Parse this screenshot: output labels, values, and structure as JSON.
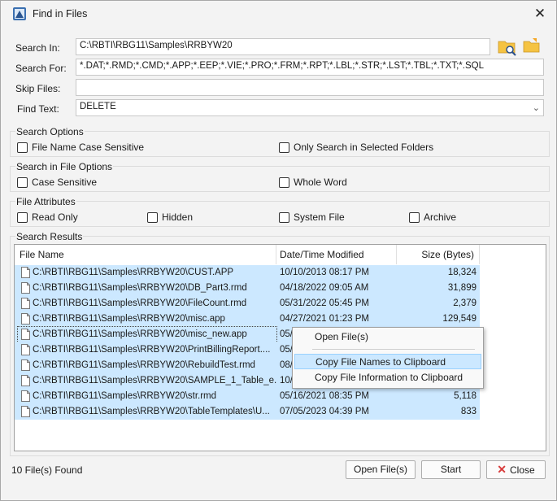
{
  "window": {
    "title": "Find in Files"
  },
  "form": {
    "search_in_label": "Search In:",
    "search_in_value": "C:\\RBTI\\RBG11\\Samples\\RRBYW20",
    "search_for_label": "Search For:",
    "search_for_value": "*.DAT;*.RMD;*.CMD;*.APP;*.EEP;*.VIE;*.PRO;*.FRM;*.RPT;*.LBL;*.STR;*.LST;*.TBL;*.TXT;*.SQL",
    "skip_files_label": "Skip Files:",
    "skip_files_value": "",
    "find_text_label": "Find Text:",
    "find_text_value": "DELETE"
  },
  "search_options": {
    "title": "Search Options",
    "file_name_case_sensitive": "File Name Case Sensitive",
    "only_selected_folders": "Only Search in Selected Folders"
  },
  "file_options": {
    "title": "Search in File Options",
    "case_sensitive": "Case Sensitive",
    "whole_word": "Whole Word"
  },
  "file_attributes": {
    "title": "File Attributes",
    "read_only": "Read Only",
    "hidden": "Hidden",
    "system_file": "System File",
    "archive": "Archive"
  },
  "results": {
    "title": "Search Results",
    "columns": [
      "File Name",
      "Date/Time Modified",
      "Size (Bytes)"
    ],
    "rows": [
      {
        "name": "C:\\RBTI\\RBG11\\Samples\\RRBYW20\\CUST.APP",
        "date": "10/10/2013 08:17 PM",
        "size": "18,324"
      },
      {
        "name": "C:\\RBTI\\RBG11\\Samples\\RRBYW20\\DB_Part3.rmd",
        "date": "04/18/2022 09:05 AM",
        "size": "31,899"
      },
      {
        "name": "C:\\RBTI\\RBG11\\Samples\\RRBYW20\\FileCount.rmd",
        "date": "05/31/2022 05:45 PM",
        "size": "2,379"
      },
      {
        "name": "C:\\RBTI\\RBG11\\Samples\\RRBYW20\\misc.app",
        "date": "04/27/2021 01:23 PM",
        "size": "129,549"
      },
      {
        "name": "C:\\RBTI\\RBG11\\Samples\\RRBYW20\\misc_new.app",
        "date": "05/",
        "size": ""
      },
      {
        "name": "C:\\RBTI\\RBG11\\Samples\\RRBYW20\\PrintBillingReport....",
        "date": "05/",
        "size": ""
      },
      {
        "name": "C:\\RBTI\\RBG11\\Samples\\RRBYW20\\RebuildTest.rmd",
        "date": "08/",
        "size": ""
      },
      {
        "name": "C:\\RBTI\\RBG11\\Samples\\RRBYW20\\SAMPLE_1_Table_e...",
        "date": "10/",
        "size": ""
      },
      {
        "name": "C:\\RBTI\\RBG11\\Samples\\RRBYW20\\str.rmd",
        "date": "05/16/2021 08:35 PM",
        "size": "5,118"
      },
      {
        "name": "C:\\RBTI\\RBG11\\Samples\\RRBYW20\\TableTemplates\\U...",
        "date": "07/05/2023 04:39 PM",
        "size": "833"
      }
    ]
  },
  "context_menu": {
    "open_files": "Open File(s)",
    "copy_names": "Copy File Names to Clipboard",
    "copy_info": "Copy File Information to Clipboard"
  },
  "footer": {
    "status": "10 File(s) Found",
    "open_label": "Open File(s)",
    "start_label": "Start",
    "close_label": "Close"
  },
  "colors": {
    "selection": "#cce8ff",
    "folder": "#f5c342",
    "close_red": "#d83b3b"
  }
}
